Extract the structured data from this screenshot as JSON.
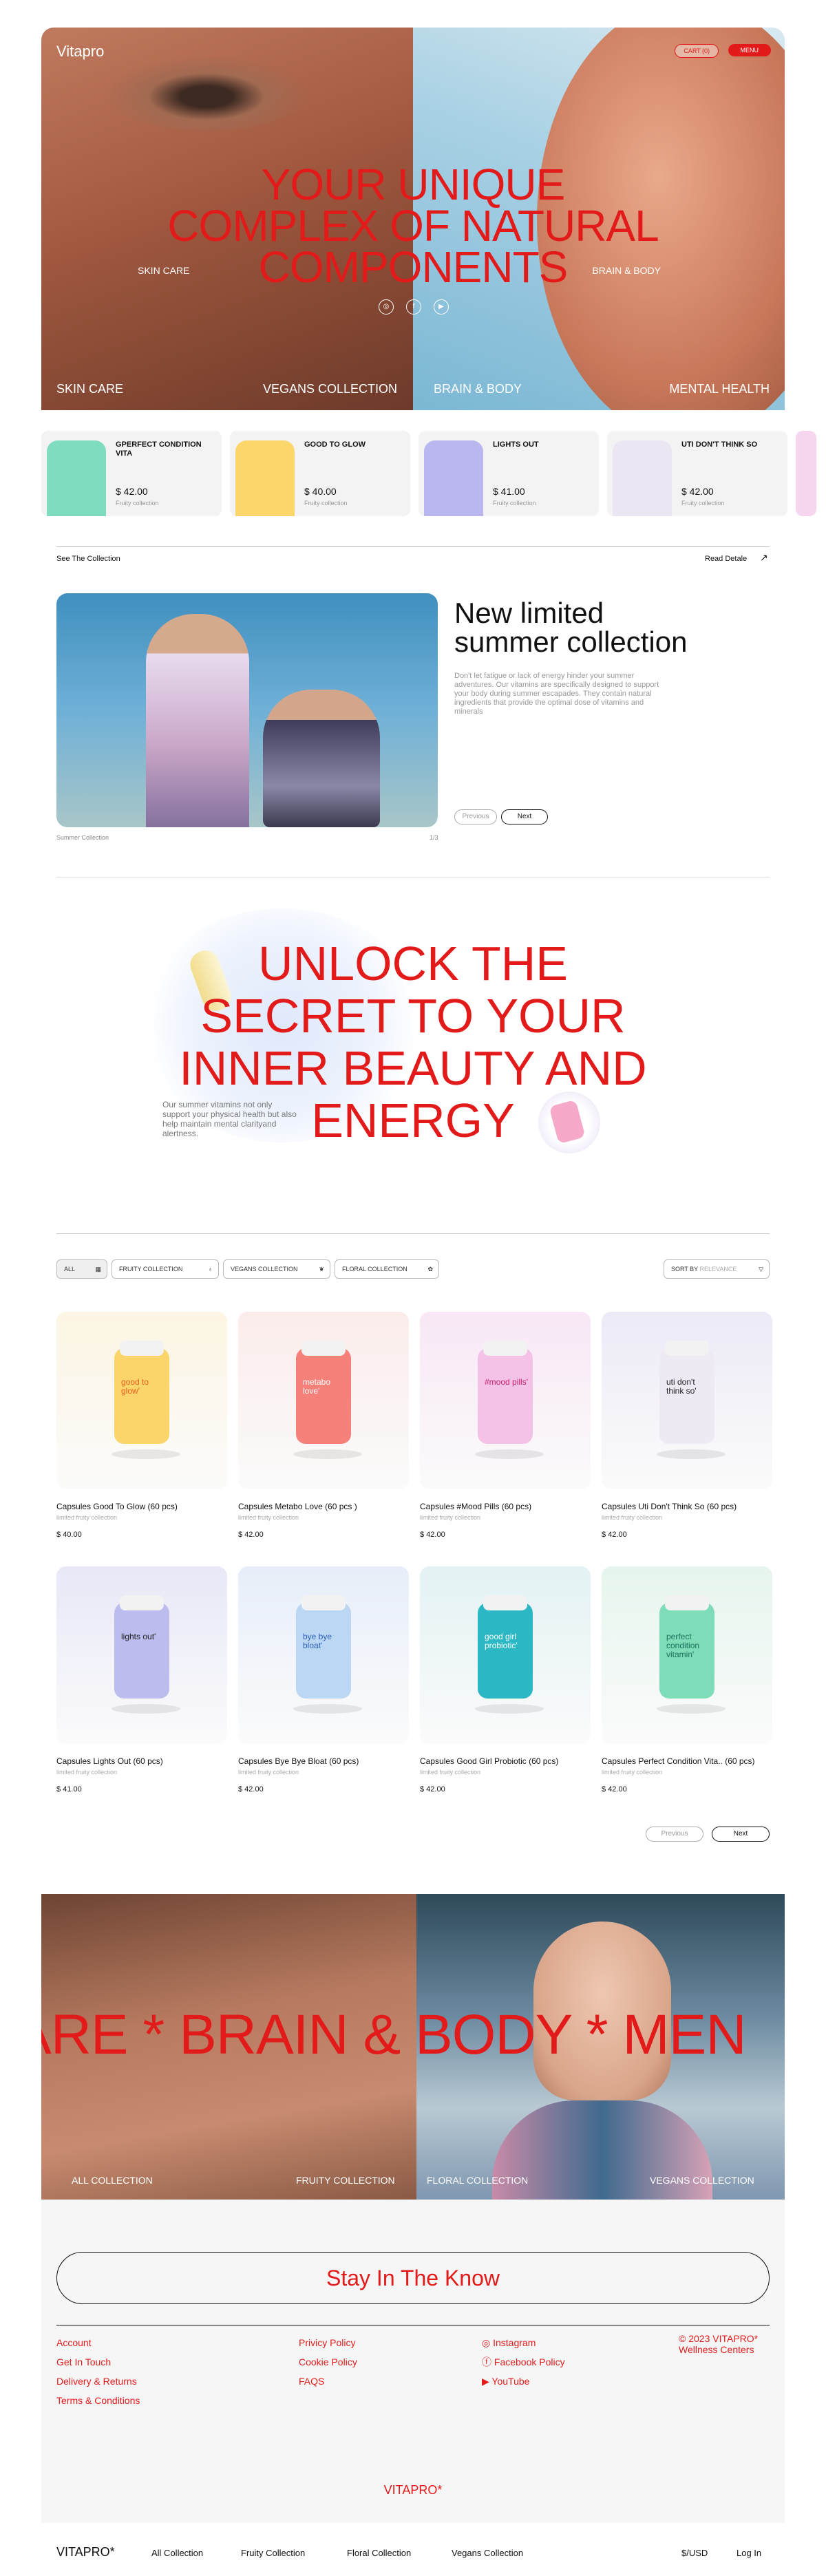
{
  "hero": {
    "logo": "Vitapro",
    "cart": "CART (0)",
    "menu": "MENU",
    "title_1": "YOUR UNIQUE",
    "title_2": "COMPLEX OF NATURAL",
    "title_3": "COMPONENTS",
    "tag_left": "SKIN CARE",
    "tag_right": "BRAIN & BODY",
    "nav": [
      "SKIN CARE",
      "VEGANS COLLECTION",
      "BRAIN & BODY",
      "MENTAL HEALTH"
    ]
  },
  "strip": [
    {
      "name": "GPERFECT CONDITION VITA",
      "price": "$ 42.00",
      "sub": "Fruity collection",
      "color": "#7fdcbe"
    },
    {
      "name": "GOOD TO GLOW",
      "price": "$ 40.00",
      "sub": "Fruity collection",
      "color": "#fbd66b"
    },
    {
      "name": "LIGHTS OUT",
      "price": "$ 41.00",
      "sub": "Fruity collection",
      "color": "#b9b7ee"
    },
    {
      "name": "UTI DON'T THINK SO",
      "price": "$ 42.00",
      "sub": "Fruity collection",
      "color": "#ebe6f1"
    }
  ],
  "collection": {
    "see": "See The Collection",
    "read": "Read Detale",
    "title_1": "New limited",
    "title_2": "summer collection",
    "body": "Don't let fatigue or lack of energy hinder your summer adventures. Our vitamins are specifically designed to support your body during summer escapades. They contain natural ingredients that provide the optimal dose of vitamins and minerals",
    "prev": "Previous",
    "next": "Next",
    "caption": "Summer Collection",
    "counter": "1/3"
  },
  "unlock": {
    "line1": "UNLOCK THE",
    "line2": "SECRET TO YOUR",
    "line3": "INNER BEAUTY AND",
    "line4": "ENERGY",
    "text": "Our summer vitamins not only support your physical health but also help maintain mental clarityand alertness."
  },
  "filters": {
    "all": "ALL",
    "fruity": "FRUITY COLLECTION",
    "vegans": "VEGANS COLLECTION",
    "floral": "FLORAL COLLECTION",
    "sort_label": "SORT BY",
    "sort_value": "RELEVANCE"
  },
  "products": [
    {
      "name": "Capsules Good To Glow  (60 pcs)",
      "sub": "limited fruity collection",
      "price": "$ 40.00",
      "label": "good to glow'",
      "bg": "#fcf5e3",
      "bottle": "#fbd56a",
      "ink": "#e4601f"
    },
    {
      "name": "Capsules Metabo Love  (60 pcs )",
      "sub": "limited fruity collection",
      "price": "$ 42.00",
      "label": "metabo love'",
      "bg": "#fbeceb",
      "bottle": "#f6807a",
      "ink": "#ffffff"
    },
    {
      "name": "Capsules #Mood Pills  (60 pcs)",
      "sub": "limited fruity collection",
      "price": "$ 42.00",
      "label": "#mood pills'",
      "bg": "#f8e7f6",
      "bottle": "#f4c2e6",
      "ink": "#c41d6b"
    },
    {
      "name": "Capsules Uti Don't Think So  (60 pcs)",
      "sub": "limited fruity collection",
      "price": "$ 42.00",
      "label": "uti don't think so'",
      "bg": "#eceaf6",
      "bottle": "#eee9f3",
      "ink": "#222222"
    },
    {
      "name": "Capsules Lights Out  (60 pcs)",
      "sub": "limited fruity collection",
      "price": "$ 41.00",
      "label": "lights out'",
      "bg": "#e8e8f8",
      "bottle": "#bcbcee",
      "ink": "#222222"
    },
    {
      "name": "Capsules Bye Bye Bloat  (60 pcs)",
      "sub": "limited fruity collection",
      "price": "$ 42.00",
      "label": "bye bye bloat'",
      "bg": "#e7eef9",
      "bottle": "#bcd7f4",
      "ink": "#2a5fb3"
    },
    {
      "name": "Capsules Good Girl Probiotic (60 pcs)",
      "sub": "limited fruity collection",
      "price": "$ 42.00",
      "label": "good girl probiotic'",
      "bg": "#e3f2f4",
      "bottle": "#2cb7c4",
      "ink": "#ffffff"
    },
    {
      "name": "Capsules Perfect Condition Vita..  (60 pcs)",
      "sub": "limited fruity collection",
      "price": "$ 42.00",
      "label": "perfect condition vitamin'",
      "bg": "#e6f5ee",
      "bottle": "#7edcb8",
      "ink": "#1c6f5a"
    }
  ],
  "pager": {
    "prev": "Previous",
    "next": "Next"
  },
  "banner": {
    "marquee": "ARE * BRAIN & BODY * MEN",
    "links": [
      "ALL COLLECTION",
      "FRUITY COLLECTION",
      "FLORAL COLLECTION",
      "VEGANS COLLECTION"
    ]
  },
  "footer": {
    "stay": "Stay In The Know",
    "col1": [
      "Account",
      "Get In Touch",
      "Delivery & Returns",
      "Terms & Conditions"
    ],
    "col2": [
      "Privicy Policy",
      "Cookie Policy",
      "FAQS"
    ],
    "col3": [
      "Instagram",
      "Facebook Policy",
      "YouTube"
    ],
    "copyright_1": "© 2023 VITAPRO*",
    "copyright_2": "Wellness Centers",
    "brand": "VITAPRO*"
  },
  "bottom": {
    "logo": "VITAPRO*",
    "links": [
      "All Collection",
      "Fruity Collection",
      "Floral Collection",
      "Vegans Collection"
    ],
    "currency": "$/USD",
    "login": "Log In"
  },
  "colors": {
    "accent": "#e21a1a"
  }
}
